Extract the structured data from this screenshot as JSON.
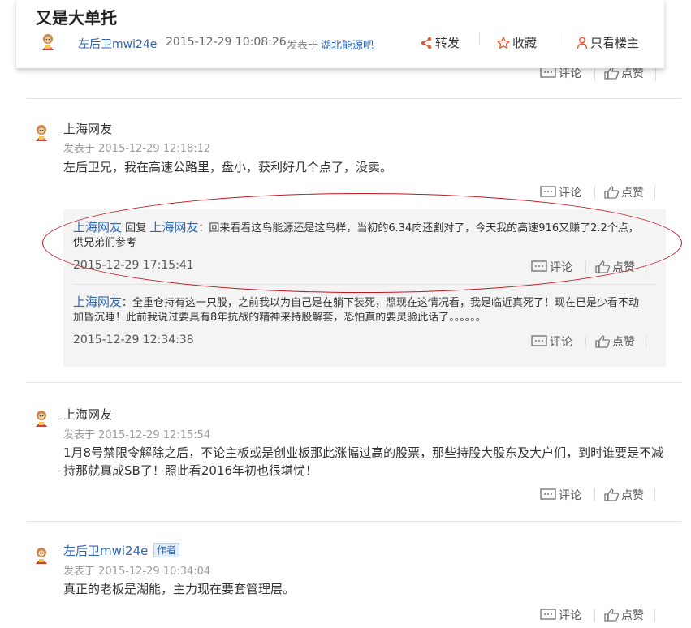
{
  "thread": {
    "title": "又是大单托",
    "author": "左后卫mwi24e",
    "time": "2015-12-29 10:08:26",
    "posted_in_label": "发表于",
    "forum": "湖北能源吧",
    "actions": {
      "forward": "转发",
      "favorite": "收藏",
      "owner_only": "只看楼主"
    }
  },
  "labels": {
    "comment": "评论",
    "like": "点赞",
    "author_badge": "作者",
    "posted_prefix": "发表于",
    "reply_word": "回复"
  },
  "posts": [
    {
      "name": "上海网友",
      "time": "发表于 2015-12-29 12:18:12",
      "content": "左后卫兄，我在高速公路里，盘小，获利好几个点了，没卖。",
      "replies": [
        {
          "user": "上海网友",
          "reply_to": "上海网友",
          "text": "：回来看看这鸟能源还是这鸟样，当初的6.34肉还割对了，今天我的高速916又赚了2.2个点，供兄弟们参考",
          "time": "2015-12-29 17:15:41"
        },
        {
          "user": "上海网友",
          "text": "：全重仓持有这一只股，之前我以为自己是在躺下装死，照现在这情况看，我是临近真死了！现在已是少看不动加昏沉睡！此前我说过要具有8年抗战的精神来持股解套，恐怕真的要灵验此话了。。。。。。",
          "time": "2015-12-29 12:34:38"
        }
      ]
    },
    {
      "name": "上海网友",
      "time": "发表于 2015-12-29 12:15:54",
      "content": "1月8号禁限令解除之后，不论主板或是创业板那此涨幅过高的股票，那些持股大股东及大户们，到时谁要是不减持那就真成SB了！照此看2016年初也很堪忧！"
    },
    {
      "name": "左后卫mwi24e",
      "time": "发表于 2015-12-29 10:34:04",
      "content": "真正的老板是湖能，主力现在要套管理层。"
    }
  ]
}
